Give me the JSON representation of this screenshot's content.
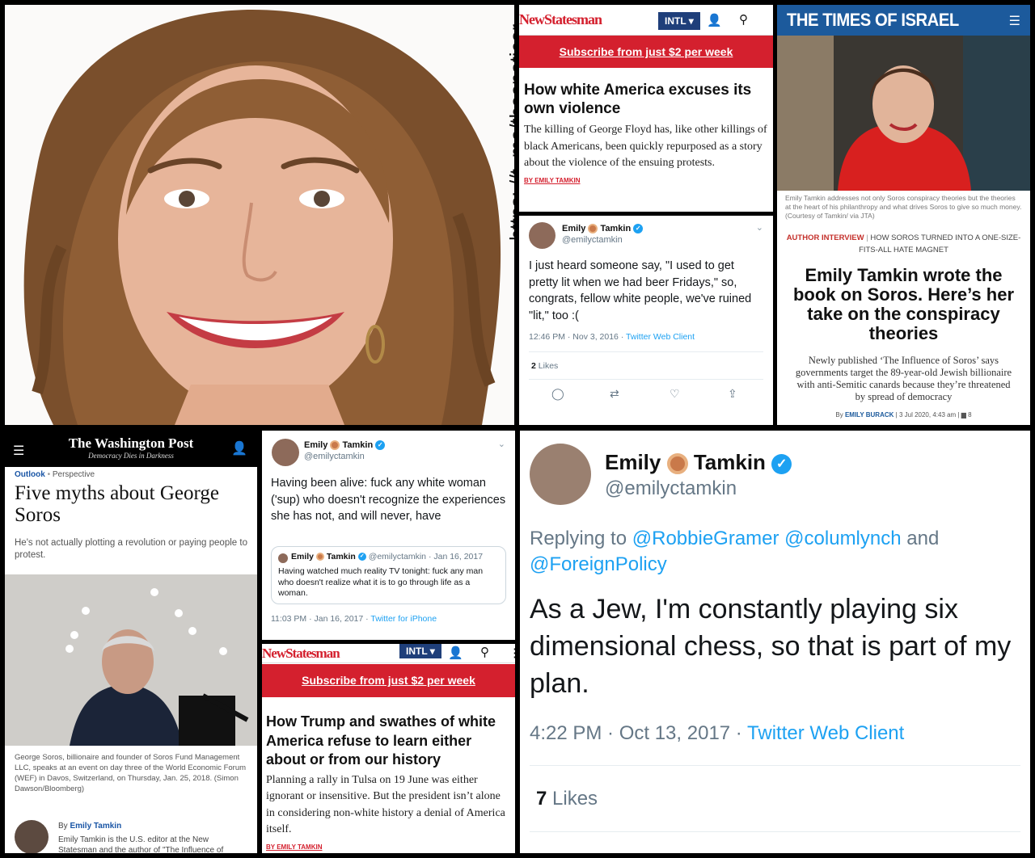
{
  "portrait": {
    "watermark": "https: //t. me/theenoticer"
  },
  "ns1": {
    "logo": "NewStatesman",
    "intl": "INTL",
    "subscribe": "Subscribe from just $2 per week",
    "title": "How white America excuses its own violence",
    "body": "The killing of George Floyd has, like other killings of black Americans, been quickly repurposed as a story about the violence of the ensuing protests.",
    "byline": "BY EMILY TAMKIN"
  },
  "toi": {
    "logo": "THE TIMES OF ISRAEL",
    "caption": "Emily Tamkin addresses not only Soros conspiracy theories but the theories at the heart of his philanthropy and what drives Soros to give so much money. (Courtesy of Tamkin/ via JTA)",
    "tag_label": "AUTHOR INTERVIEW",
    "tag_text": "HOW SOROS TURNED INTO A ONE-SIZE-FITS-ALL HATE MAGNET",
    "title": "Emily Tamkin wrote the book on Soros. Here’s her take on the conspiracy theories",
    "dek": "Newly published ‘The Influence of Soros’ says governments target the 89-year-old Jewish billionaire with anti-Semitic canards because they’re threatened by spread of democracy",
    "meta_by": "By",
    "meta_author": "EMILY BURACK",
    "meta_date": "3 Jul 2020, 4:43 am",
    "meta_comments": "8"
  },
  "tweet1": {
    "name_first": "Emily",
    "name_last": "Tamkin",
    "handle": "@emilyctamkin",
    "text": "I just heard someone say, \"I used to get pretty lit when we had beer Fridays,\" so, congrats, fellow white people, we've ruined \"lit,\" too :(",
    "time": "12:46 PM · Nov 3, 2016 · ",
    "client": "Twitter Web Client",
    "likes_count": "2",
    "likes_label": "Likes"
  },
  "wapo": {
    "logo": "The Washington Post",
    "tagline": "Democracy Dies in Darkness",
    "section": "Outlook",
    "section2": "Perspective",
    "title": "Five myths about George Soros",
    "dek": "He's not actually plotting a revolution or paying people to protest.",
    "caption": "George Soros, billionaire and founder of Soros Fund Management LLC, speaks at an event on day three of the World Economic Forum (WEF) in Davos, Switzerland, on Thursday, Jan. 25, 2018. (Simon Dawson/Bloomberg)",
    "by_label": "By",
    "by_author": "Emily Tamkin",
    "bio": "Emily Tamkin is the U.S. editor at the New Statesman and the author of \"The Influence of"
  },
  "tweet2": {
    "name_first": "Emily",
    "name_last": "Tamkin",
    "handle": "@emilyctamkin",
    "text": "Having been alive: fuck any white woman ('sup) who doesn't recognize the experiences she has not, and will never, have",
    "quote_handle": "@emilyctamkin · Jan 16, 2017",
    "quote_text": "Having watched much reality TV tonight: fuck any man who doesn't realize what it is to go through life as a woman.",
    "time": "11:03 PM · Jan 16, 2017 · ",
    "client": "Twitter for iPhone"
  },
  "ns2": {
    "logo": "NewStatesman",
    "intl": "INTL",
    "subscribe": "Subscribe from just $2 per week",
    "title": "How Trump and swathes of white America refuse to learn either about or from our history",
    "body": "Planning a rally in Tulsa on 19 June was either ignorant or insensitive. But the president isn’t alone in considering non-white history a denial of America itself.",
    "byline": "BY EMILY TAMKIN"
  },
  "tweet3": {
    "name_first": "Emily",
    "name_last": "Tamkin",
    "handle": "@emilyctamkin",
    "reply_prefix": "Replying to ",
    "reply_mentions": "@RobbieGramer @columlynch",
    "reply_and": " and",
    "reply_mention2": "@ForeignPolicy",
    "text": "As a Jew, I'm constantly playing six dimensional chess, so that is part of my plan.",
    "time": "4:22 PM · Oct 13, 2017 · ",
    "client": "Twitter Web Client",
    "likes_count": "7",
    "likes_label": "Likes"
  }
}
